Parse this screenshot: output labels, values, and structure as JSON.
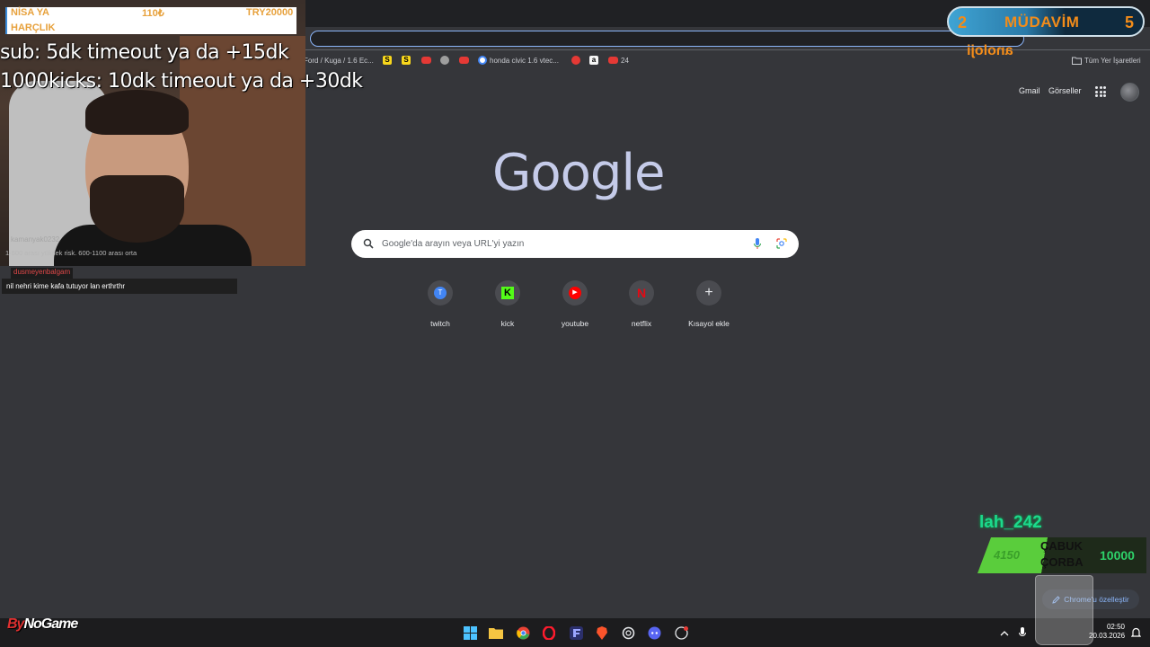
{
  "browser": {
    "bookmarks": [
      {
        "label": "Ford / Kuga / 1.6 Ec...",
        "color": "#9aa0a6"
      },
      {
        "label": "",
        "color": "#f9d71c",
        "letter": "S"
      },
      {
        "label": "",
        "color": "#f9d71c",
        "letter": "S"
      },
      {
        "label": "",
        "color": "#e53935"
      },
      {
        "label": "",
        "color": "#9e9e9e"
      },
      {
        "label": "",
        "color": "#e53935"
      },
      {
        "label": "honda civic 1.6 vtec...",
        "color": "#4285f4"
      },
      {
        "label": "",
        "color": "#e53935"
      },
      {
        "label": "",
        "color": "#f5f5f5",
        "letter": "a"
      },
      {
        "label": "24",
        "color": "#e53935"
      }
    ],
    "all_bookmarks_label": "Tüm Yer İşaretleri"
  },
  "ntp": {
    "gmail": "Gmail",
    "images": "Görseller",
    "logo": "Google",
    "search_placeholder": "Google'da arayın veya URL'yi yazın",
    "shortcuts": [
      {
        "label": "twitch",
        "icon": "twitch-icon",
        "color": "#4285f4",
        "glyph": "T"
      },
      {
        "label": "kick",
        "icon": "kick-icon",
        "color": "#53fc18",
        "glyph": "K"
      },
      {
        "label": "youtube",
        "icon": "youtube-icon",
        "color": "#ff0000",
        "glyph": "▶"
      },
      {
        "label": "netflix",
        "icon": "netflix-icon",
        "color": "#e50914",
        "glyph": "N"
      },
      {
        "label": "Kısayol ekle",
        "icon": "plus-icon",
        "color": "#e8eaed",
        "glyph": "+"
      }
    ],
    "customize": "Chrome'u özelleştir"
  },
  "taskbar": {
    "time": "02:50",
    "date": "20.03.2026"
  },
  "overlay": {
    "donate": {
      "l1": "NİSA YA",
      "l2": "HARÇLIK",
      "amount": "110₺",
      "goal": "TRY20000"
    },
    "line1": "sub: 5dk timeout ya da +15dk",
    "line2": "1000kicks: 10dk timeout ya da +30dk",
    "cam_user": "kamanyak0232",
    "cam_risk": "1-600 arası yüksek risk. 600-1100 arası orta",
    "chat_user": "dusmeyenbalgam",
    "chat_msg": "nil nehri kime kafa tutuyor lan erthrthr",
    "mudavim_left": "2",
    "mudavim_title": "MÜDAVİM",
    "mudavim_right": "5",
    "anoloji": "anoloji",
    "lah": "lah_242",
    "corba_val": "4150",
    "corba_l1": "ÇABUK",
    "corba_l2": "ÇORBA",
    "corba_amt": "10000",
    "bynogame_a": "By",
    "bynogame_b": "NoGame"
  }
}
